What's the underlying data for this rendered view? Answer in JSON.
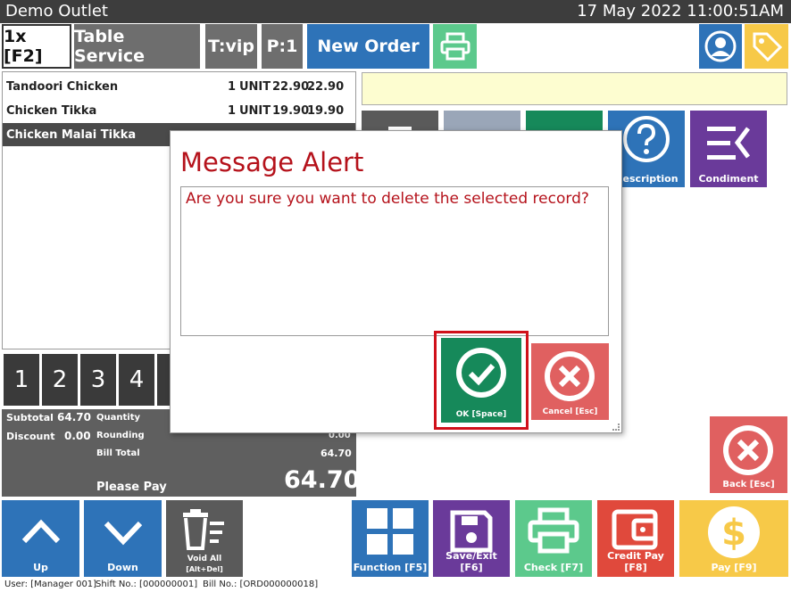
{
  "titlebar": {
    "outlet": "Demo Outlet",
    "datetime": "17 May 2022 11:00:51AM"
  },
  "topbar": {
    "qty_label": "1x [F2]",
    "service_label": "Table Service",
    "table_label": "T:vip",
    "pax_label": "P:1",
    "new_order_label": "New Order"
  },
  "order": {
    "items": [
      {
        "name": "Tandoori Chicken",
        "qty": "1",
        "unit": "UNIT",
        "price": "22.90",
        "total": "22.90"
      },
      {
        "name": "Chicken Tikka",
        "qty": "1",
        "unit": "UNIT",
        "price": "19.90",
        "total": "19.90"
      },
      {
        "name": "Chicken Malai Tikka",
        "qty": "",
        "unit": "",
        "price": "",
        "total": ""
      }
    ]
  },
  "actions": {
    "description_label": "Description",
    "condiment_label": "Condiment"
  },
  "numpad": [
    "1",
    "2",
    "3",
    "4"
  ],
  "totals": {
    "subtotal_label": "Subtotal",
    "subtotal_value": "64.70",
    "discount_label": "Discount",
    "discount_value": "0.00",
    "quantity_label": "Quantity",
    "rounding_label": "Rounding",
    "rounding_value": "0.00",
    "billtotal_label": "Bill Total",
    "billtotal_value": "64.70",
    "pleasepay_label": "Please Pay",
    "pleasepay_value": "64.70"
  },
  "bottom": {
    "up_label": "Up",
    "down_label": "Down",
    "voidall_label": "Void All",
    "voidall_hint": "[Alt+Del]",
    "function_label": "Function [F5]",
    "saveexit_label": "Save/Exit [F6]",
    "check_label": "Check [F7]",
    "creditpay_label": "Credit Pay [F8]",
    "pay_label": "Pay [F9]",
    "back_label": "Back [Esc]"
  },
  "status": {
    "user": "User: [Manager 001]",
    "shift": "Shift No.: [000000001]",
    "bill": "Bill No.: [ORD000000018]"
  },
  "dialog": {
    "title": "Message Alert",
    "message": "Are you sure you want to delete the selected record?",
    "ok_label": "OK [Space]",
    "cancel_label": "Cancel [Esc]"
  },
  "colors": {
    "accent_blue": "#2e73b8",
    "green": "#5cc98c",
    "dark_green": "#16895a",
    "red": "#e06060",
    "purple": "#6a3a9a",
    "orange_red": "#e0493c",
    "yellow": "#f7c948",
    "alert_red": "#b5121b"
  }
}
